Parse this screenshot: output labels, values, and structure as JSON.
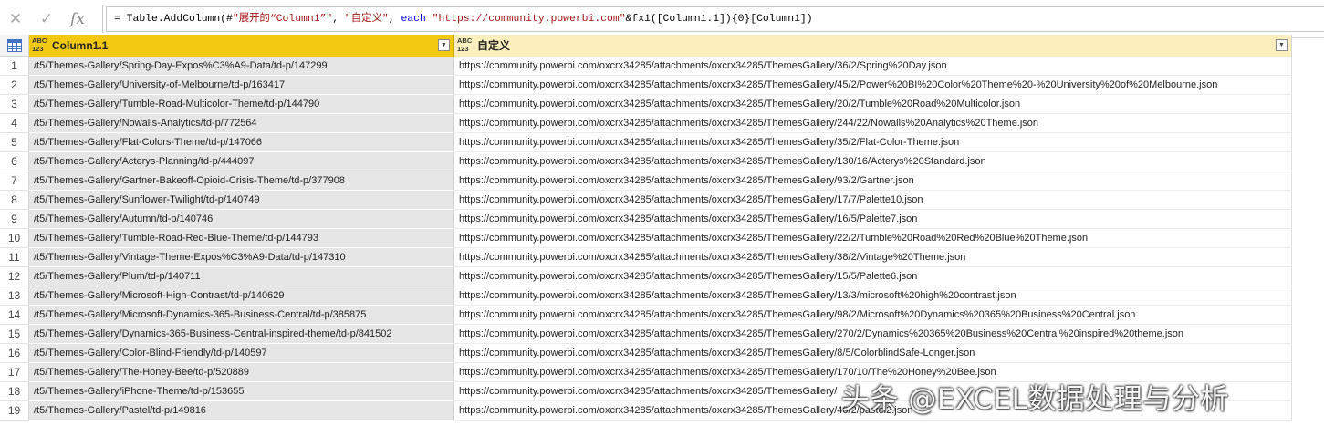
{
  "formula_bar": {
    "icons": [
      "cancel-icon",
      "confirm-icon",
      "fx-icon"
    ],
    "fx_label": "fx",
    "tokens": [
      {
        "t": "= Table.AddColumn(#",
        "c": "plain"
      },
      {
        "t": "\"展开的“Column1”\"",
        "c": "str"
      },
      {
        "t": ", ",
        "c": "plain"
      },
      {
        "t": "\"自定义\"",
        "c": "str"
      },
      {
        "t": ", ",
        "c": "plain"
      },
      {
        "t": "each",
        "c": "kw"
      },
      {
        "t": " ",
        "c": "plain"
      },
      {
        "t": "\"https://community.powerbi.com\"",
        "c": "str"
      },
      {
        "t": "&fx1([Column1.1]){0}[Column1])",
        "c": "plain"
      }
    ]
  },
  "columns": [
    {
      "type_icon": "ABC\n123",
      "label": "Column1.1"
    },
    {
      "type_icon": "ABC\n123",
      "label": "自定义"
    }
  ],
  "rows": [
    [
      "1",
      "/t5/Themes-Gallery/Spring-Day-Expos%C3%A9-Data/td-p/147299",
      "https://community.powerbi.com/oxcrx34285/attachments/oxcrx34285/ThemesGallery/36/2/Spring%20Day.json"
    ],
    [
      "2",
      "/t5/Themes-Gallery/University-of-Melbourne/td-p/163417",
      "https://community.powerbi.com/oxcrx34285/attachments/oxcrx34285/ThemesGallery/45/2/Power%20BI%20Color%20Theme%20-%20University%20of%20Melbourne.json"
    ],
    [
      "3",
      "/t5/Themes-Gallery/Tumble-Road-Multicolor-Theme/td-p/144790",
      "https://community.powerbi.com/oxcrx34285/attachments/oxcrx34285/ThemesGallery/20/2/Tumble%20Road%20Multicolor.json"
    ],
    [
      "4",
      "/t5/Themes-Gallery/Nowalls-Analytics/td-p/772564",
      "https://community.powerbi.com/oxcrx34285/attachments/oxcrx34285/ThemesGallery/244/22/Nowalls%20Analytics%20Theme.json"
    ],
    [
      "5",
      "/t5/Themes-Gallery/Flat-Colors-Theme/td-p/147066",
      "https://community.powerbi.com/oxcrx34285/attachments/oxcrx34285/ThemesGallery/35/2/Flat-Color-Theme.json"
    ],
    [
      "6",
      "/t5/Themes-Gallery/Acterys-Planning/td-p/444097",
      "https://community.powerbi.com/oxcrx34285/attachments/oxcrx34285/ThemesGallery/130/16/Acterys%20Standard.json"
    ],
    [
      "7",
      "/t5/Themes-Gallery/Gartner-Bakeoff-Opioid-Crisis-Theme/td-p/377908",
      "https://community.powerbi.com/oxcrx34285/attachments/oxcrx34285/ThemesGallery/93/2/Gartner.json"
    ],
    [
      "8",
      "/t5/Themes-Gallery/Sunflower-Twilight/td-p/140749",
      "https://community.powerbi.com/oxcrx34285/attachments/oxcrx34285/ThemesGallery/17/7/Palette10.json"
    ],
    [
      "9",
      "/t5/Themes-Gallery/Autumn/td-p/140746",
      "https://community.powerbi.com/oxcrx34285/attachments/oxcrx34285/ThemesGallery/16/5/Palette7.json"
    ],
    [
      "10",
      "/t5/Themes-Gallery/Tumble-Road-Red-Blue-Theme/td-p/144793",
      "https://community.powerbi.com/oxcrx34285/attachments/oxcrx34285/ThemesGallery/22/2/Tumble%20Road%20Red%20Blue%20Theme.json"
    ],
    [
      "11",
      "/t5/Themes-Gallery/Vintage-Theme-Expos%C3%A9-Data/td-p/147310",
      "https://community.powerbi.com/oxcrx34285/attachments/oxcrx34285/ThemesGallery/38/2/Vintage%20Theme.json"
    ],
    [
      "12",
      "/t5/Themes-Gallery/Plum/td-p/140711",
      "https://community.powerbi.com/oxcrx34285/attachments/oxcrx34285/ThemesGallery/15/5/Palette6.json"
    ],
    [
      "13",
      "/t5/Themes-Gallery/Microsoft-High-Contrast/td-p/140629",
      "https://community.powerbi.com/oxcrx34285/attachments/oxcrx34285/ThemesGallery/13/3/microsoft%20high%20contrast.json"
    ],
    [
      "14",
      "/t5/Themes-Gallery/Microsoft-Dynamics-365-Business-Central/td-p/385875",
      "https://community.powerbi.com/oxcrx34285/attachments/oxcrx34285/ThemesGallery/98/2/Microsoft%20Dynamics%20365%20Business%20Central.json"
    ],
    [
      "15",
      "/t5/Themes-Gallery/Dynamics-365-Business-Central-inspired-theme/td-p/841502",
      "https://community.powerbi.com/oxcrx34285/attachments/oxcrx34285/ThemesGallery/270/2/Dynamics%20365%20Business%20Central%20inspired%20theme.json"
    ],
    [
      "16",
      "/t5/Themes-Gallery/Color-Blind-Friendly/td-p/140597",
      "https://community.powerbi.com/oxcrx34285/attachments/oxcrx34285/ThemesGallery/8/5/ColorblindSafe-Longer.json"
    ],
    [
      "17",
      "/t5/Themes-Gallery/The-Honey-Bee/td-p/520889",
      "https://community.powerbi.com/oxcrx34285/attachments/oxcrx34285/ThemesGallery/170/10/The%20Honey%20Bee.json"
    ],
    [
      "18",
      "/t5/Themes-Gallery/iPhone-Theme/td-p/153655",
      "https://community.powerbi.com/oxcrx34285/attachments/oxcrx34285/ThemesGallery/"
    ],
    [
      "19",
      "/t5/Themes-Gallery/Pastel/td-p/149816",
      "https://community.powerbi.com/oxcrx34285/attachments/oxcrx34285/ThemesGallery/40/2/pastel2.json"
    ]
  ],
  "watermark": "头条 @EXCEL数据处理与分析",
  "colors": {
    "selected_header": "#f2c811",
    "header": "#fbefbd",
    "selected_column": "#e6e6e6",
    "string_token": "#a31515",
    "keyword_token": "#0000ff"
  }
}
